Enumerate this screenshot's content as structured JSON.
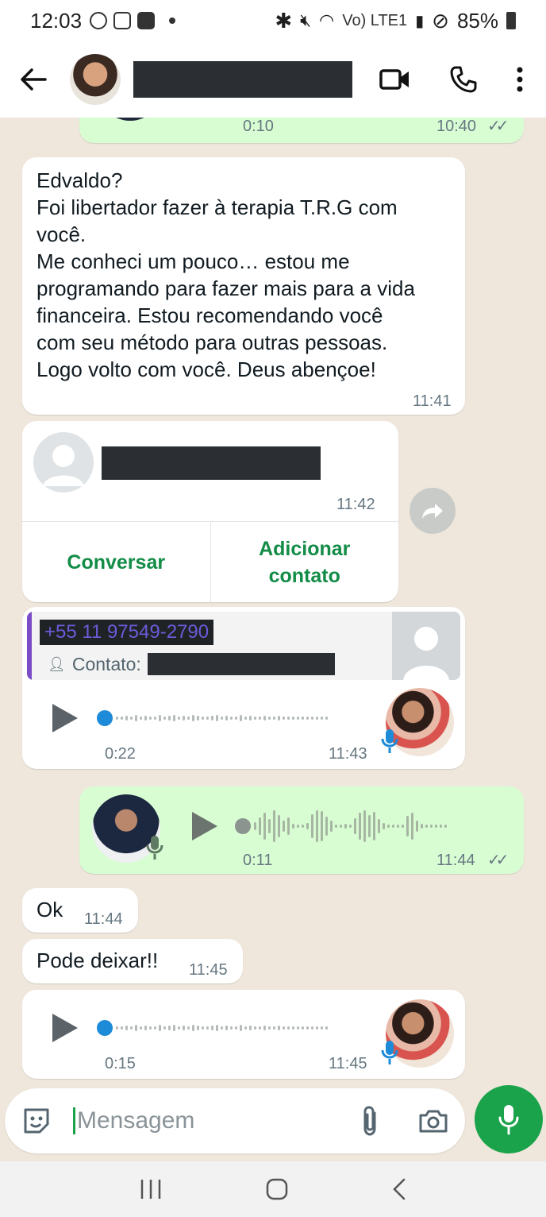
{
  "status_bar": {
    "time": "12:03",
    "network": "Vo) LTE1",
    "battery": "85%"
  },
  "header": {
    "contact_name_redacted": true
  },
  "messages": {
    "voice_top": {
      "duration": "0:10",
      "time": "10:40"
    },
    "text_1": {
      "lines": [
        "Edvaldo?",
        "Foi libertador fazer à terapia T.R.G com",
        "você.",
        "Me conheci um pouco… estou me",
        "programando para fazer mais para a vida",
        "financeira.  Estou recomendando você",
        "com seu método para outras pessoas.",
        "Logo volto com você. Deus abençoe!"
      ],
      "time": "11:41"
    },
    "contact_card": {
      "time": "11:42",
      "action_message": "Conversar",
      "action_add_line1": "Adicionar",
      "action_add_line2": "contato"
    },
    "voice_reply": {
      "quoted_phone": "+55 11 97549-2790",
      "quoted_label": "Contato:",
      "duration": "0:22",
      "time": "11:43"
    },
    "voice_out": {
      "duration": "0:11",
      "time": "11:44"
    },
    "ok": {
      "text": "Ok",
      "time": "11:44"
    },
    "pode": {
      "text": "Pode deixar!!",
      "time": "11:45"
    },
    "voice_last": {
      "duration": "0:15",
      "time": "11:45"
    }
  },
  "input": {
    "placeholder": "Mensagem"
  },
  "icons": {
    "back": "arrow-left-icon",
    "video": "video-call-icon",
    "phone": "phone-icon",
    "menu": "more-vert-icon",
    "emoji": "sticker-icon",
    "attach": "paperclip-icon",
    "camera": "camera-icon",
    "mic": "mic-icon",
    "forward": "forward-icon"
  },
  "colors": {
    "outgoing_bubble": "#d9fdd3",
    "incoming_bubble": "#ffffff",
    "accent_green": "#1aa34a",
    "chat_background": "#efe7dc",
    "link_green": "#128c47"
  }
}
